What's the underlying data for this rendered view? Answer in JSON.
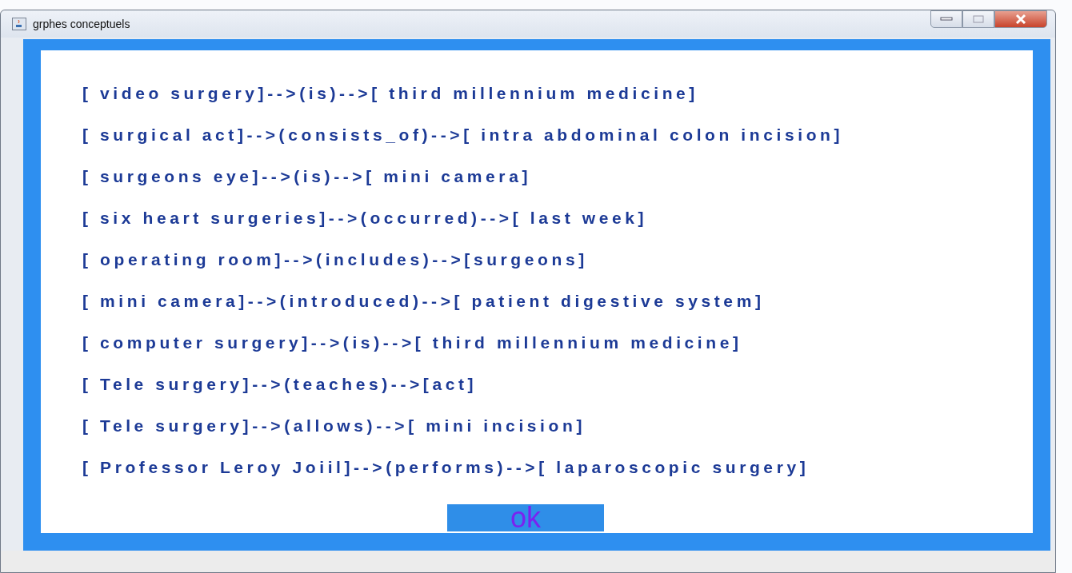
{
  "window": {
    "title": "grphes conceptuels"
  },
  "relations": [
    "[ video surgery]-->(is)-->[ third millennium medicine]",
    "[ surgical act]-->(consists_of)-->[ intra abdominal colon incision]",
    "[ surgeons eye]-->(is)-->[ mini camera]",
    "[ six heart surgeries]-->(occurred)-->[ last week]",
    "[ operating room]-->(includes)-->[surgeons]",
    "[ mini camera]-->(introduced)-->[ patient digestive system]",
    "[ computer surgery]-->(is)-->[ third millennium medicine]",
    "[ Tele surgery]-->(teaches)-->[act]",
    "[ Tele surgery]-->(allows)-->[ mini incision]",
    "[ Professor Leroy Joiil]-->(performs)-->[ laparoscopic surgery]"
  ],
  "button": "ok"
}
